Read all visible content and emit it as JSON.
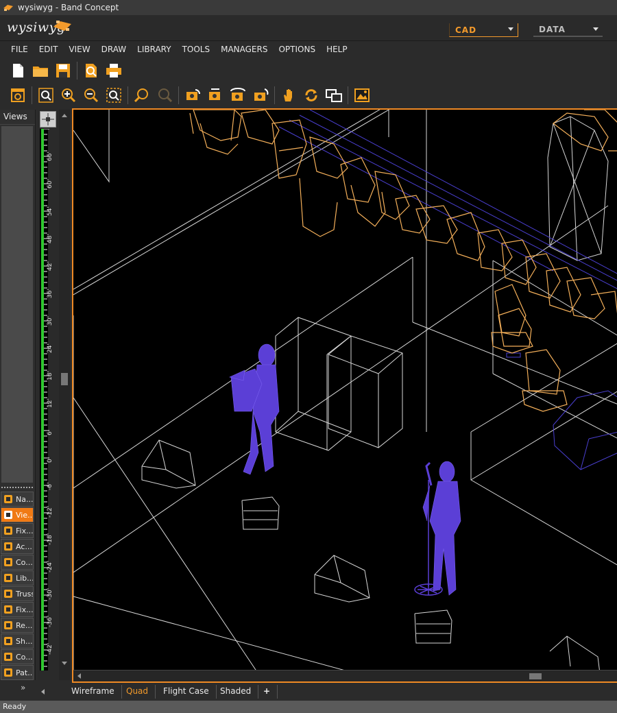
{
  "window": {
    "title": "wysiwyg - Band Concept"
  },
  "brand": {
    "logo_text": "wysiwyg"
  },
  "modes": {
    "cad_label": "CAD",
    "data_label": "DATA"
  },
  "menu": [
    "FILE",
    "EDIT",
    "VIEW",
    "DRAW",
    "LIBRARY",
    "TOOLS",
    "MANAGERS",
    "OPTIONS",
    "HELP"
  ],
  "left_panel": {
    "title": "Views",
    "nav_items": [
      {
        "label": "Na...",
        "icon": "star-icon",
        "color": "#f0a020"
      },
      {
        "label": "Vie...",
        "icon": "views-icon",
        "color": "#ffffff",
        "active": true
      },
      {
        "label": "Fix...",
        "icon": "fixture-icon",
        "color": "#f0a020"
      },
      {
        "label": "Ac...",
        "icon": "accessory-icon",
        "color": "#f0a020"
      },
      {
        "label": "Co...",
        "icon": "color-icon",
        "color": "#f0a020"
      },
      {
        "label": "Lib...",
        "icon": "library-icon",
        "color": "#f0a020"
      },
      {
        "label": "Truss",
        "icon": "truss-icon",
        "color": "#f0a020"
      },
      {
        "label": "Fix...",
        "icon": "fixture-list-icon",
        "color": "#f0a020"
      },
      {
        "label": "Re...",
        "icon": "render-icon",
        "color": "#f0a020"
      },
      {
        "label": "Sh...",
        "icon": "shutter-icon",
        "color": "#f0a020"
      },
      {
        "label": "Co...",
        "icon": "console-icon",
        "color": "#f0a020"
      },
      {
        "label": "Pat...",
        "icon": "patch-icon",
        "color": "#f0a020"
      }
    ]
  },
  "ruler": {
    "labels": [
      "66'",
      "60'",
      "54'",
      "48'",
      "42'",
      "36'",
      "30'",
      "24'",
      "18'",
      "12'",
      "6'",
      "0'",
      "-6'",
      "-12'",
      "-18'",
      "-24'",
      "-30'",
      "-36'",
      "-42'"
    ]
  },
  "tabs": [
    {
      "label": "Wireframe"
    },
    {
      "label": "Quad",
      "active": true
    },
    {
      "label": "Flight Case"
    },
    {
      "label": "Shaded"
    },
    {
      "label": "+"
    }
  ],
  "status": {
    "text": "Ready"
  },
  "colors": {
    "accent": "#f08a24",
    "fixture": "#f5b05a",
    "performer": "#5b3fd6",
    "wire": "#d8d8d8"
  }
}
